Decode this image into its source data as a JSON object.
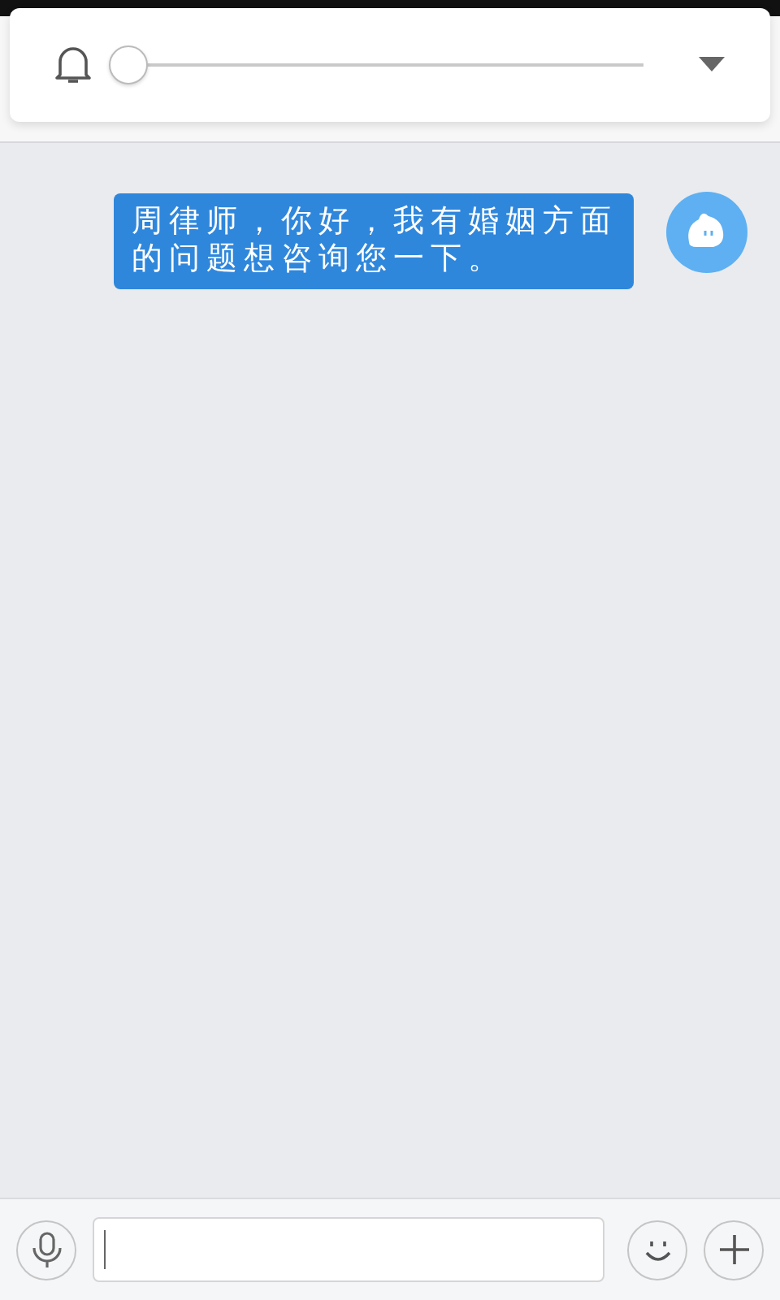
{
  "volume_panel": {
    "level": 0
  },
  "messages": [
    {
      "kind": "outgoing",
      "text": "周律师，你好，我有婚姻方面的问题想咨询您一下。"
    }
  ]
}
